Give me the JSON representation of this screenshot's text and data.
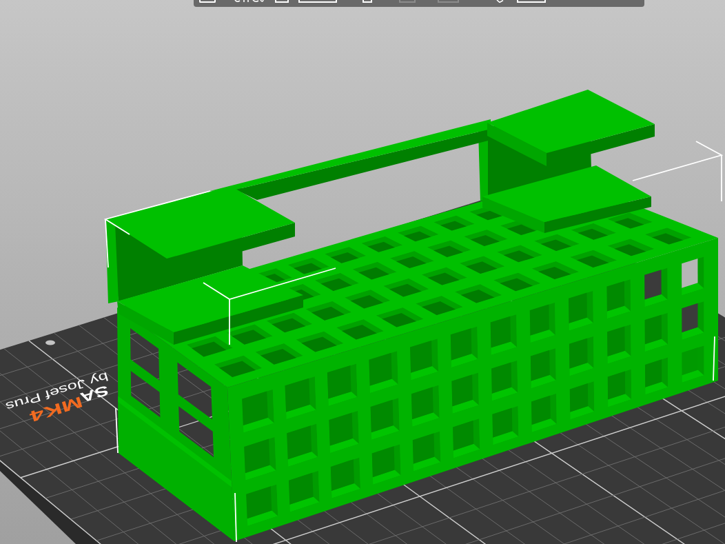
{
  "viewport": {
    "bed": {
      "labels": [
        {
          "kind": "brand",
          "text": "SA"
        },
        {
          "kind": "model",
          "text": "MK4"
        },
        {
          "kind": "maker",
          "text": "by Josef Prus"
        }
      ]
    }
  }
}
